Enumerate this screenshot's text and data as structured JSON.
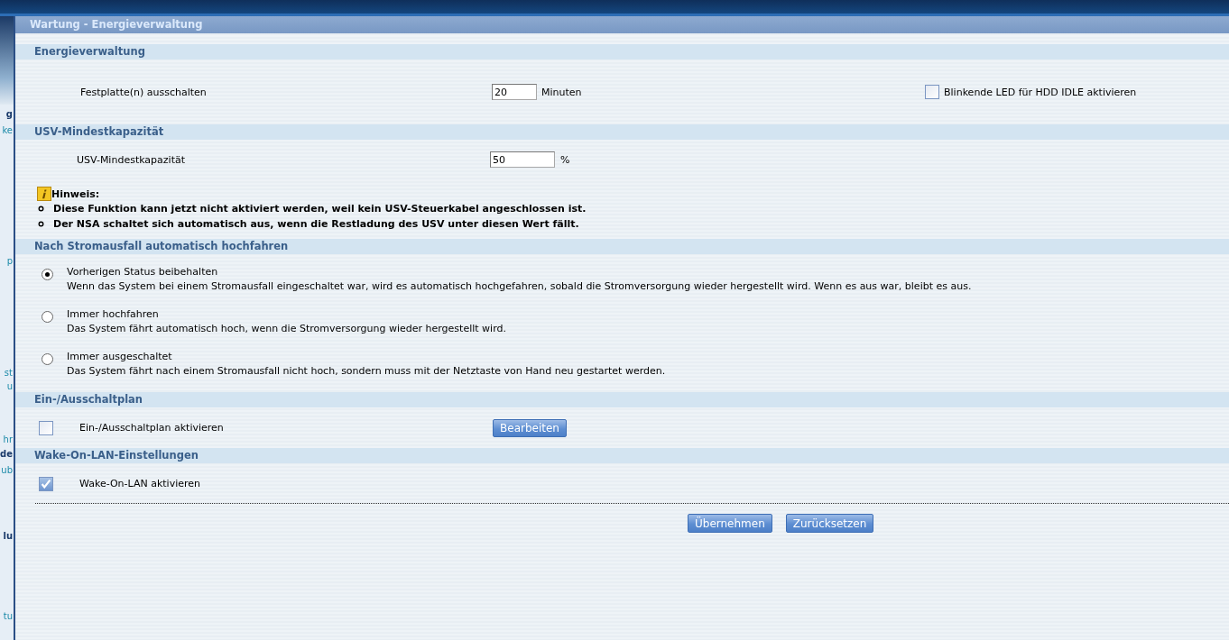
{
  "sidebar_fragments": [
    {
      "text": "g",
      "bold": true
    },
    {
      "text": "ke",
      "bold": false
    },
    {
      "text": "p",
      "bold": false
    },
    {
      "text": "st",
      "bold": false
    },
    {
      "text": "u",
      "bold": false
    },
    {
      "text": "hr",
      "bold": false
    },
    {
      "text": "de",
      "bold": true
    },
    {
      "text": "ub",
      "bold": false
    },
    {
      "text": "lu",
      "bold": true
    },
    {
      "text": "tu",
      "bold": false
    }
  ],
  "window": {
    "title": "Wartung - Energieverwaltung"
  },
  "sections": [
    {
      "title": "Energieverwaltung",
      "kind": "field",
      "label": "Festplatte(n) ausschalten",
      "value": "20",
      "unit": "Minuten",
      "side_checkbox": {
        "label": "Blinkende LED für HDD IDLE aktivieren",
        "checked": false
      }
    },
    {
      "title": "USV-Mindestkapazität",
      "kind": "field",
      "label": "USV-Mindestkapazität",
      "value": "50",
      "unit": "%",
      "note": {
        "title": "Hinweis:",
        "items": [
          "Diese Funktion kann jetzt nicht aktiviert werden, weil kein USV-Steuerkabel angeschlossen ist.",
          "Der NSA schaltet sich automatisch aus, wenn die Restladung des USV unter diesen Wert fällt."
        ]
      }
    },
    {
      "title": "Nach Stromausfall automatisch hochfahren",
      "kind": "radios",
      "options": [
        {
          "label": "Vorherigen Status beibehalten",
          "description": "Wenn das System bei einem Stromausfall eingeschaltet war, wird es automatisch hochgefahren, sobald die Stromversorgung wieder hergestellt wird. Wenn es aus war, bleibt es aus.",
          "selected": true
        },
        {
          "label": "Immer hochfahren",
          "description": "Das System fährt automatisch hoch, wenn die Stromversorgung wieder hergestellt wird.",
          "selected": false
        },
        {
          "label": "Immer ausgeschaltet",
          "description": "Das System fährt nach einem Stromausfall nicht hoch, sondern muss mit der Netztaste von Hand neu gestartet werden.",
          "selected": false
        }
      ]
    },
    {
      "title": "Ein-/Ausschaltplan",
      "kind": "checkbox",
      "label": "Ein-/Ausschaltplan aktivieren",
      "checked": false,
      "button": "Bearbeiten"
    },
    {
      "title": "Wake-On-LAN-Einstellungen",
      "kind": "checkbox",
      "label": "Wake-On-LAN aktivieren",
      "checked": true
    }
  ],
  "buttons": [
    "Übernehmen",
    "Zurücksetzen"
  ]
}
